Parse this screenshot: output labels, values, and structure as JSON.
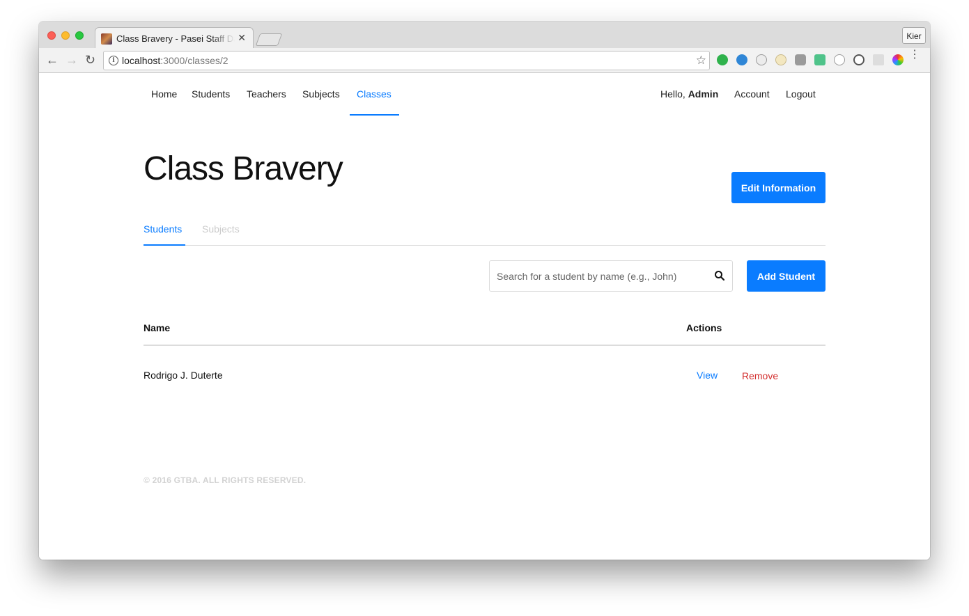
{
  "browser": {
    "tab_title": "Class Bravery - Pasei Staff Dashboard",
    "tab_close": "✕",
    "profile_name": "Kier",
    "url_host": "localhost",
    "url_path": ":3000/classes/2",
    "icons": {
      "back": "←",
      "forward": "→",
      "reload": "↻",
      "star": "☆",
      "menu": "⋮"
    }
  },
  "nav": {
    "items": [
      {
        "label": "Home",
        "active": false
      },
      {
        "label": "Students",
        "active": false
      },
      {
        "label": "Teachers",
        "active": false
      },
      {
        "label": "Subjects",
        "active": false
      },
      {
        "label": "Classes",
        "active": true
      }
    ],
    "greeting": "Hello,",
    "user": "Admin",
    "account": "Account",
    "logout": "Logout"
  },
  "header": {
    "title": "Class Bravery",
    "edit_button": "Edit Information"
  },
  "tabs": [
    {
      "label": "Students",
      "active": true
    },
    {
      "label": "Subjects",
      "active": false
    }
  ],
  "toolbar": {
    "search_placeholder": "Search for a student by name (e.g., John)",
    "add_button": "Add Student"
  },
  "table": {
    "columns": [
      "Name",
      "Actions"
    ],
    "rows": [
      {
        "name": "Rodrigo J. Duterte",
        "view": "View",
        "remove": "Remove"
      }
    ]
  },
  "footer": "© 2016 GTBA. ALL RIGHTS RESERVED.",
  "colors": {
    "accent": "#0a7cff",
    "danger": "#d32f2f",
    "muted": "#cccccc"
  }
}
